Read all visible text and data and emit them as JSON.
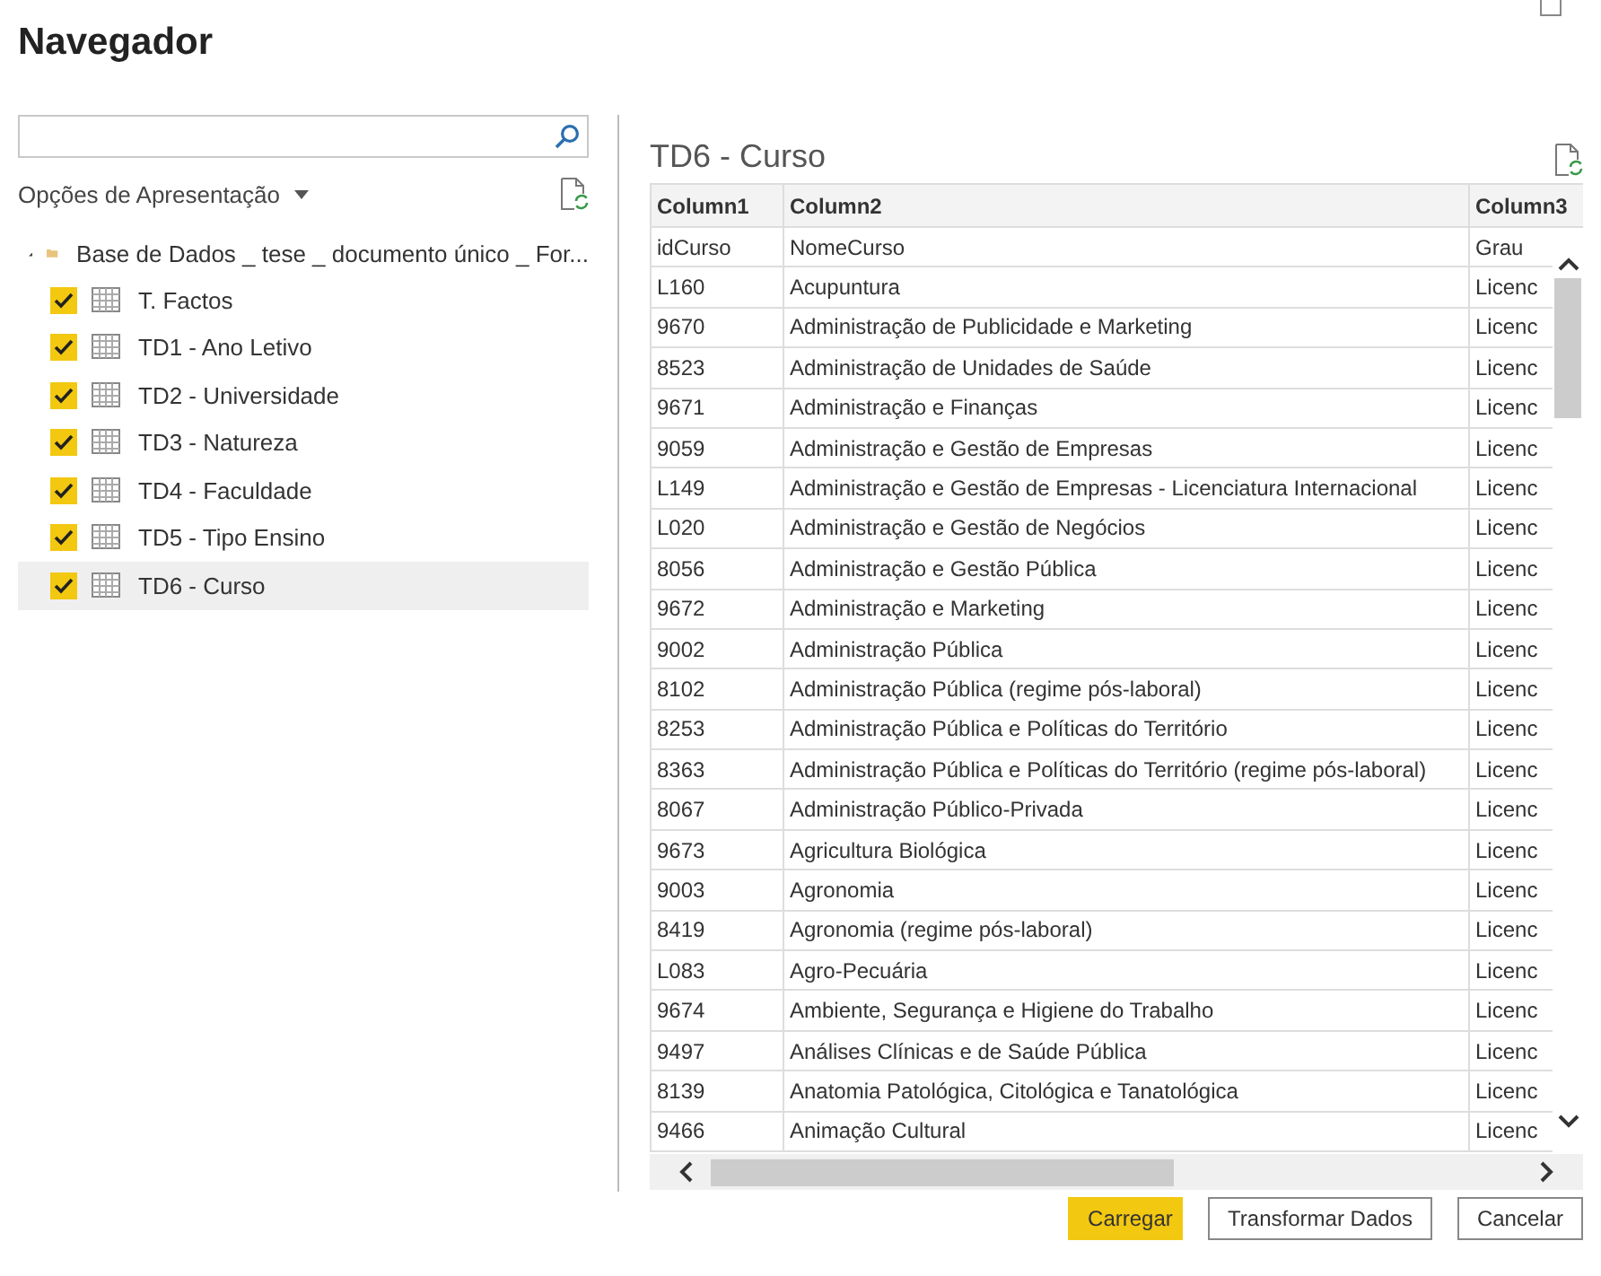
{
  "window": {
    "title": "Navegador"
  },
  "display_options": {
    "label": "Opções de Apresentação"
  },
  "tree": {
    "label": "Base de Dados _ tese _ documento único _ For...",
    "expanded": true,
    "children": [
      {
        "label": "T. Factos",
        "checked": true,
        "selected": false
      },
      {
        "label": "TD1 - Ano Letivo",
        "checked": true,
        "selected": false
      },
      {
        "label": "TD2 - Universidade",
        "checked": true,
        "selected": false
      },
      {
        "label": "TD3 - Natureza",
        "checked": true,
        "selected": false
      },
      {
        "label": "TD4 - Faculdade",
        "checked": true,
        "selected": false
      },
      {
        "label": "TD5 - Tipo Ensino",
        "checked": true,
        "selected": false
      },
      {
        "label": "TD6 - Curso",
        "checked": true,
        "selected": true
      }
    ]
  },
  "preview": {
    "title": "TD6 - Curso",
    "columns": [
      "Column1",
      "Column2",
      "Column3"
    ],
    "rows": [
      [
        "idCurso",
        "NomeCurso",
        "Grau"
      ],
      [
        "L160",
        "Acupuntura",
        "Licenc"
      ],
      [
        "9670",
        "Administração de Publicidade e Marketing",
        "Licenc"
      ],
      [
        "8523",
        "Administração de Unidades de Saúde",
        "Licenc"
      ],
      [
        "9671",
        "Administração e Finanças",
        "Licenc"
      ],
      [
        "9059",
        "Administração e Gestão de Empresas",
        "Licenc"
      ],
      [
        "L149",
        "Administração e Gestão de Empresas - Licenciatura Internacional",
        "Licenc"
      ],
      [
        "L020",
        "Administração e Gestão de Negócios",
        "Licenc"
      ],
      [
        "8056",
        "Administração e Gestão Pública",
        "Licenc"
      ],
      [
        "9672",
        "Administração e Marketing",
        "Licenc"
      ],
      [
        "9002",
        "Administração Pública",
        "Licenc"
      ],
      [
        "8102",
        "Administração Pública (regime pós-laboral)",
        "Licenc"
      ],
      [
        "8253",
        "Administração Pública e Políticas do Território",
        "Licenc"
      ],
      [
        "8363",
        "Administração Pública e Políticas do Território (regime pós-laboral)",
        "Licenc"
      ],
      [
        "8067",
        "Administração Público-Privada",
        "Licenc"
      ],
      [
        "9673",
        "Agricultura Biológica",
        "Licenc"
      ],
      [
        "9003",
        "Agronomia",
        "Licenc"
      ],
      [
        "8419",
        "Agronomia (regime pós-laboral)",
        "Licenc"
      ],
      [
        "L083",
        "Agro-Pecuária",
        "Licenc"
      ],
      [
        "9674",
        "Ambiente, Segurança e Higiene do Trabalho",
        "Licenc"
      ],
      [
        "9497",
        "Análises Clínicas e de Saúde Pública",
        "Licenc"
      ],
      [
        "8139",
        "Anatomia Patológica, Citológica e Tanatológica",
        "Licenc"
      ],
      [
        "9466",
        "Animação Cultural",
        "Licenc"
      ]
    ]
  },
  "buttons": [
    {
      "label": "Carregar",
      "kind": "primary"
    },
    {
      "label": "Transformar Dados",
      "kind": "secondary"
    },
    {
      "label": "Cancelar",
      "kind": "secondary"
    }
  ]
}
